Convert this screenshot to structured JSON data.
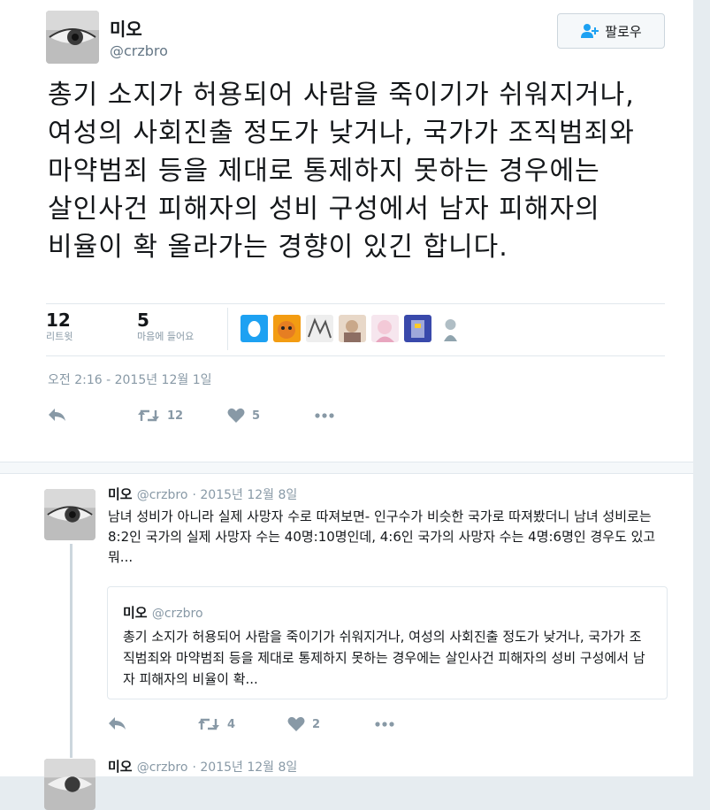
{
  "tweet": {
    "name": "미오",
    "handle": "@crzbro",
    "follow_label": "팔로우",
    "text": "총기 소지가 허용되어 사람을 죽이기가 쉬워지거나, 여성의 사회진출 정도가 낮거나, 국가가 조직범죄와 마약범죄 등을 제대로 통제하지 못하는 경우에는 살인사건 피해자의 성비 구성에서 남자 피해자의 비율이 확 올라가는 경향이 있긴 합니다.",
    "retweets": "12",
    "retweets_label": "리트윗",
    "likes": "5",
    "likes_label": "마음에 들어요",
    "timestamp": "오전 2:16 - 2015년 12월 1일",
    "action_retweet_count": "12",
    "action_like_count": "5"
  },
  "reply1": {
    "name": "미오",
    "handle": "@crzbro",
    "date": "· 2015년 12월 8일",
    "text": "남녀 성비가 아니라 실제 사망자 수로 따져보면- 인구수가 비슷한 국가로 따져봤더니 남녀 성비로는 8:2인 국가의 실제 사망자 수는 40명:10명인데, 4:6인 국가의 사망자 수는 4명:6명인 경우도 있고 뭐...",
    "quote": {
      "name": "미오",
      "handle": "@crzbro",
      "text": "총기 소지가 허용되어 사람을 죽이기가 쉬워지거나, 여성의 사회진출 정도가 낮거나, 국가가 조직범죄와 마약범죄 등을 제대로 통제하지 못하는 경우에는 살인사건 피해자의 성비 구성에서 남자 피해자의 비율이 확..."
    },
    "retweets": "4",
    "likes": "2"
  },
  "reply2": {
    "name": "미오",
    "handle": "@crzbro",
    "date": "· 2015년 12월 8일"
  },
  "colors": {
    "text": "#14171a",
    "muted": "#8899a6",
    "border": "#e1e8ed",
    "accent": "#1da1f2"
  },
  "icons": {
    "follow": "add-user-icon",
    "reply": "reply-icon",
    "retweet": "retweet-icon",
    "like": "heart-icon",
    "more": "more-icon"
  }
}
